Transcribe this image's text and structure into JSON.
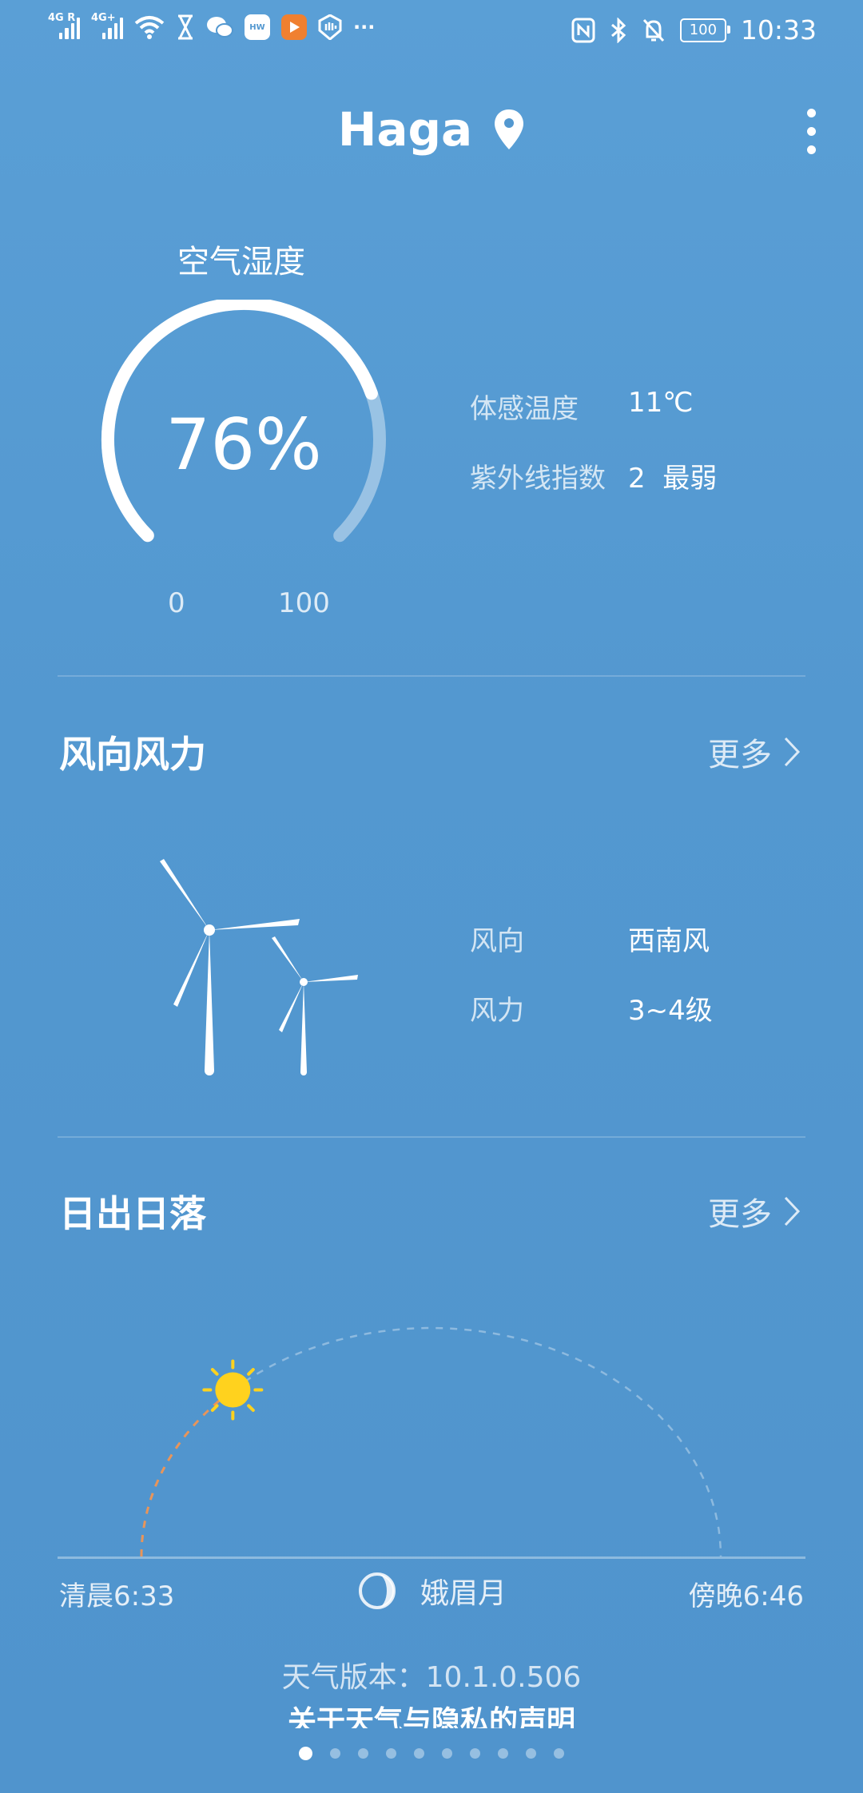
{
  "status_bar": {
    "net1": "4G R",
    "net2": "4G+",
    "time": "10:33",
    "battery": "100",
    "more": "···"
  },
  "header": {
    "city": "Haga"
  },
  "humidity": {
    "title": "空气湿度",
    "value_text": "76%",
    "level": 0.76,
    "min": "0",
    "max": "100"
  },
  "details": [
    {
      "label": "体感温度",
      "value": "11℃"
    },
    {
      "label": "紫外线指数",
      "value": "2  最弱"
    }
  ],
  "wind": {
    "title": "风向风力",
    "more": "更多",
    "direction_label": "风向",
    "direction": "西南风",
    "force_label": "风力",
    "force": "3~4级"
  },
  "sun": {
    "title": "日出日落",
    "more": "更多",
    "sunrise": "清晨6:33",
    "sunset": "傍晚6:46",
    "moon_phase": "娥眉月",
    "progress": 0.26
  },
  "footer": {
    "version": "天气版本：10.1.0.506",
    "privacy": "关于天气与隐私的声明"
  },
  "pager": {
    "count": 10,
    "active": 0
  },
  "colors": {
    "background": "#5398d0",
    "sun": "#ffd21e",
    "sun_path_elapsed": "#e8955a"
  }
}
